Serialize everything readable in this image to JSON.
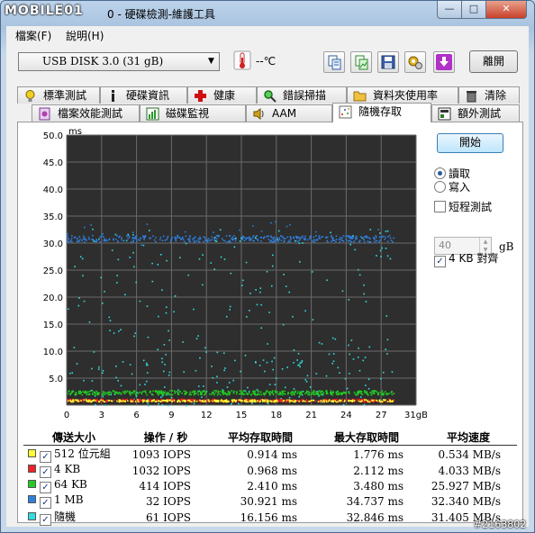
{
  "window": {
    "logo": "MOBILE01",
    "title": "0 - 硬碟檢測-維護工具",
    "minimize": "—",
    "maximize": "□",
    "close": "✕"
  },
  "menu": [
    {
      "label": "檔案(F)"
    },
    {
      "label": "說明(H)"
    }
  ],
  "toolbar": {
    "drive": "USB DISK 3.0    (31 gB)",
    "temperature": "--℃",
    "exit_label": "離開",
    "tool_icons": [
      "copy-text-icon",
      "copy-image-icon",
      "save-icon",
      "settings-icon",
      "download-icon"
    ]
  },
  "tabs_top": [
    {
      "label": "標準測試",
      "icon": "bulb-icon"
    },
    {
      "label": "硬碟資訊",
      "icon": "info-icon"
    },
    {
      "label": "健康",
      "icon": "health-cross-icon"
    },
    {
      "label": "錯誤掃描",
      "icon": "magnifier-icon"
    },
    {
      "label": "資料夾使用率",
      "icon": "folder-icon"
    },
    {
      "label": "清除",
      "icon": "trash-icon"
    }
  ],
  "tabs_bottom": [
    {
      "label": "檔案效能測試",
      "icon": "file-icon"
    },
    {
      "label": "磁碟監視",
      "icon": "monitor-chart-icon"
    },
    {
      "label": "AAM",
      "icon": "speaker-icon"
    },
    {
      "label": "隨機存取",
      "icon": "random-dots-icon",
      "active": true
    },
    {
      "label": "額外測試",
      "icon": "extra-test-icon"
    }
  ],
  "controls": {
    "start_label": "開始",
    "read_label": "讀取",
    "write_label": "寫入",
    "mode_selected": "讀取",
    "short_test_label": "短程測試",
    "short_test_checked": false,
    "short_test_value": "40",
    "short_test_unit": "gB",
    "align_label": "4 KB 對齊",
    "align_checked": true
  },
  "chart_data": {
    "type": "scatter",
    "ylabel": "ms",
    "xlabel": "",
    "xlim": [
      0,
      31
    ],
    "ylim": [
      0,
      50
    ],
    "x_ticks": [
      "0",
      "3",
      "6",
      "9",
      "12",
      "15",
      "18",
      "21",
      "24",
      "27",
      "31gB"
    ],
    "y_ticks": [
      "5.0",
      "10.0",
      "15.0",
      "20.0",
      "25.0",
      "30.0",
      "35.0",
      "40.0",
      "45.0",
      "50.0"
    ],
    "grid": true,
    "background": "#2e2e2e",
    "series": [
      {
        "name": "512 位元組",
        "color": "#ffff33",
        "typical_ms": 0.914,
        "max_ms": 1.776
      },
      {
        "name": "4 KB",
        "color": "#ee2222",
        "typical_ms": 0.968,
        "max_ms": 2.112
      },
      {
        "name": "64 KB",
        "color": "#22cc22",
        "typical_ms": 2.41,
        "max_ms": 3.48
      },
      {
        "name": "1 MB",
        "color": "#2f7fe0",
        "typical_ms": 30.921,
        "max_ms": 34.737
      },
      {
        "name": "隨機",
        "color": "#33dddd",
        "typical_ms": 16.156,
        "max_ms": 32.846
      }
    ]
  },
  "results": {
    "headers": [
      "傳送大小",
      "操作 / 秒",
      "平均存取時間",
      "最大存取時間",
      "平均速度"
    ],
    "rows": [
      {
        "size": "512 位元組",
        "color": "#ffff33",
        "checked": true,
        "iops": "1093 IOPS",
        "avg": "0.914 ms",
        "max": "1.776 ms",
        "speed": "0.534 MB/s"
      },
      {
        "size": "4 KB",
        "color": "#ee2222",
        "checked": true,
        "iops": "1032 IOPS",
        "avg": "0.968 ms",
        "max": "2.112 ms",
        "speed": "4.033 MB/s"
      },
      {
        "size": "64 KB",
        "color": "#22cc22",
        "checked": true,
        "iops": "414 IOPS",
        "avg": "2.410 ms",
        "max": "3.480 ms",
        "speed": "25.927 MB/s"
      },
      {
        "size": "1 MB",
        "color": "#2f7fe0",
        "checked": true,
        "iops": "32 IOPS",
        "avg": "30.921 ms",
        "max": "34.737 ms",
        "speed": "32.340 MB/s"
      },
      {
        "size": "隨機",
        "color": "#33dddd",
        "checked": true,
        "iops": "61 IOPS",
        "avg": "16.156 ms",
        "max": "32.846 ms",
        "speed": "31.405 MB/s"
      }
    ]
  },
  "watermark": "#2163802"
}
